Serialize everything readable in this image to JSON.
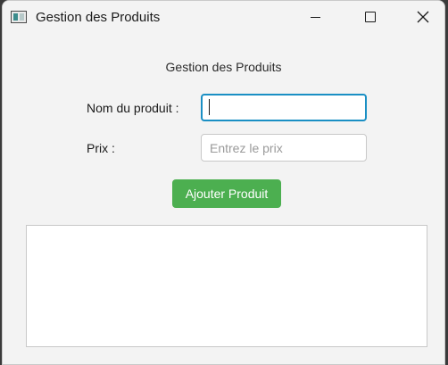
{
  "window": {
    "title": "Gestion des Produits",
    "icons": {
      "app": "app-icon",
      "minimize": "minimize-icon",
      "maximize": "maximize-icon",
      "close": "close-icon"
    },
    "close_glyph": "✕"
  },
  "form": {
    "heading": "Gestion des Produits",
    "name_label": "Nom du produit :",
    "name_value": "",
    "price_label": "Prix :",
    "price_placeholder": "Entrez le prix",
    "price_value": "",
    "add_button_label": "Ajouter Produit"
  },
  "colors": {
    "accent_button": "#4caf50",
    "focus_border": "#1a8fc4",
    "window_bg": "#f3f3f3"
  },
  "product_list": {
    "items": []
  }
}
